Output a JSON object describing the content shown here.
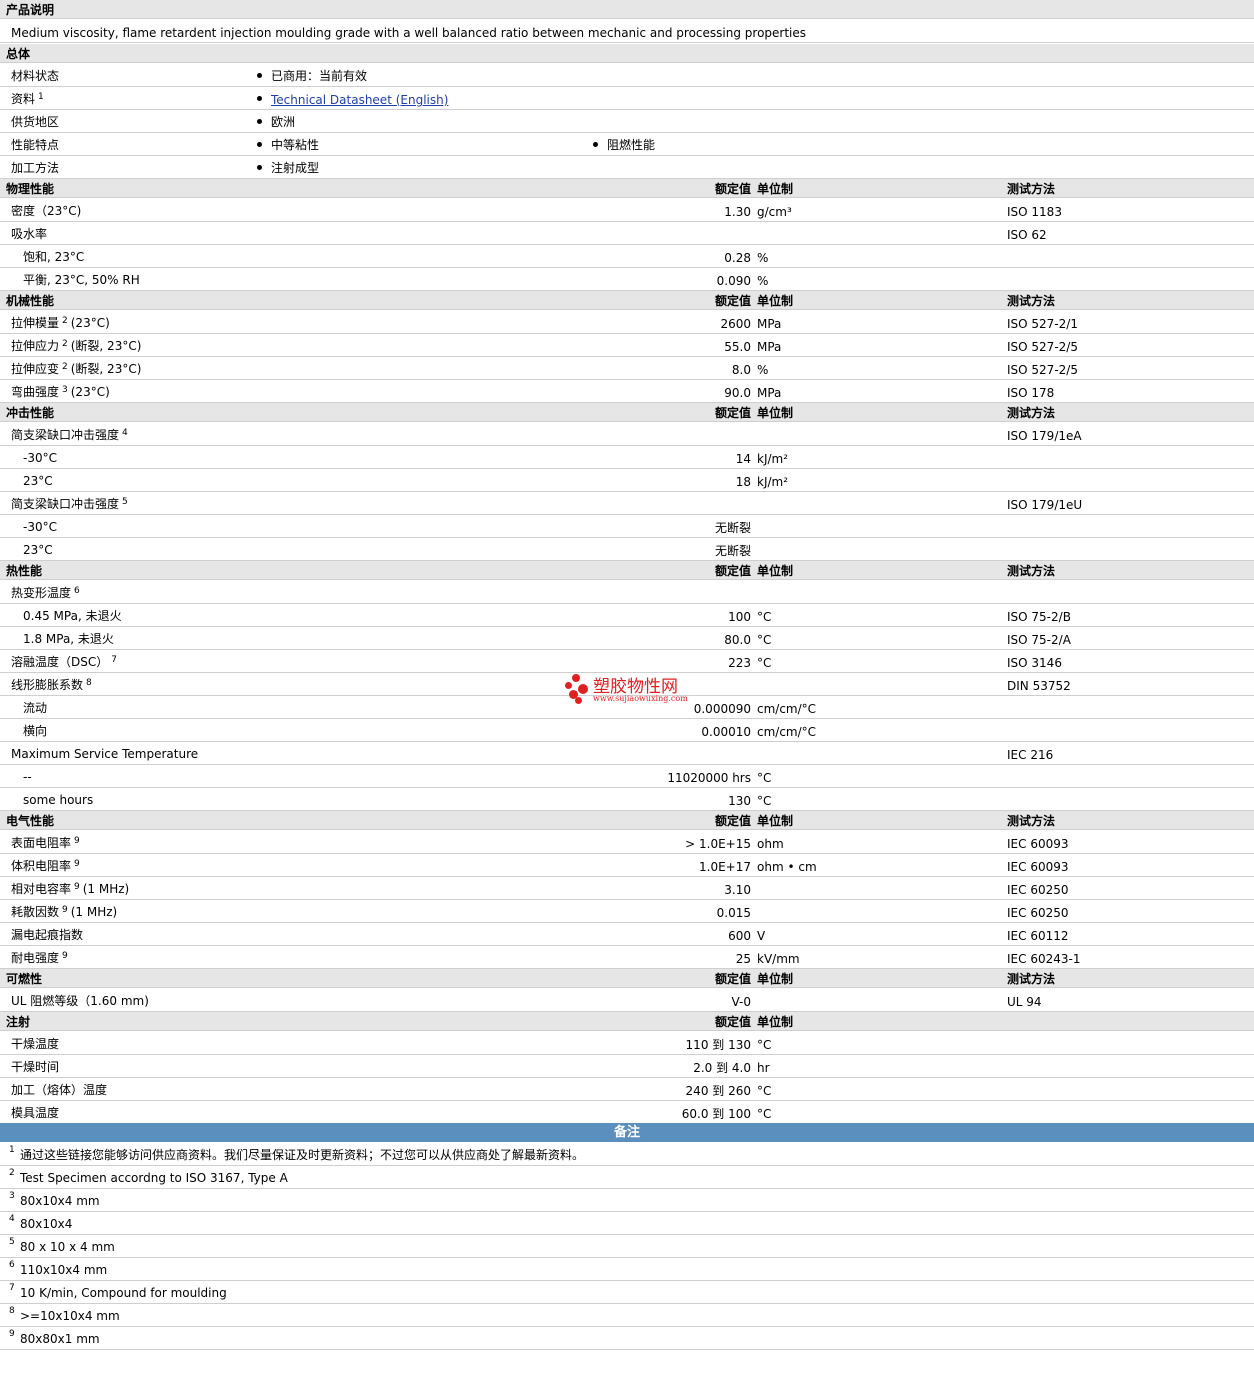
{
  "description": {
    "title": "产品说明",
    "text": "Medium viscosity, flame retardent injection moulding grade with a well balanced ratio between mechanic and processing properties"
  },
  "general": {
    "title": "总体",
    "rows": [
      {
        "label": "材料状态",
        "v1": "已商用：当前有效"
      },
      {
        "label": "资料",
        "sup": "1",
        "v1": "Technical Datasheet (English)"
      },
      {
        "label": "供货地区",
        "v1": "欧洲"
      },
      {
        "label": "性能特点",
        "v1": "中等粘性",
        "v2": "阻燃性能"
      },
      {
        "label": "加工方法",
        "v1": "注射成型"
      }
    ]
  },
  "columns": {
    "value": "额定值",
    "unit": "单位制",
    "method": "测试方法"
  },
  "sections": {
    "physical": {
      "title": "物理性能",
      "rows": [
        {
          "label": "密度（23°C)",
          "value": "1.30",
          "unit": "g/cm³",
          "method": "ISO 1183"
        },
        {
          "label": "吸水率",
          "method": "ISO 62"
        },
        {
          "label": "饱和, 23°C",
          "value": "0.28",
          "unit": "%"
        },
        {
          "label": "平衡, 23°C, 50% RH",
          "value": "0.090",
          "unit": "%"
        }
      ]
    },
    "mechanical": {
      "title": "机械性能",
      "rows": [
        {
          "label": "拉伸模量",
          "sup": "2",
          "suffix": "(23°C)",
          "value": "2600",
          "unit": "MPa",
          "method": "ISO 527-2/1"
        },
        {
          "label": "拉伸应力",
          "sup": "2",
          "suffix": "(断裂, 23°C)",
          "value": "55.0",
          "unit": "MPa",
          "method": "ISO 527-2/5"
        },
        {
          "label": "拉伸应变",
          "sup": "2",
          "suffix": "(断裂, 23°C)",
          "value": "8.0",
          "unit": "%",
          "method": "ISO 527-2/5"
        },
        {
          "label": "弯曲强度",
          "sup": "3",
          "suffix": "(23°C)",
          "value": "90.0",
          "unit": "MPa",
          "method": "ISO 178"
        }
      ]
    },
    "impact": {
      "title": "冲击性能",
      "rows": [
        {
          "label": "简支梁缺口冲击强度",
          "sup": "4",
          "method": "ISO 179/1eA"
        },
        {
          "label": "-30°C",
          "value": "14",
          "unit": "kJ/m²"
        },
        {
          "label": "23°C",
          "value": "18",
          "unit": "kJ/m²"
        },
        {
          "label": "简支梁缺口冲击强度",
          "sup": "5",
          "method": "ISO 179/1eU"
        },
        {
          "label": "-30°C",
          "value": "无断裂"
        },
        {
          "label": "23°C",
          "value": "无断裂"
        }
      ]
    },
    "thermal": {
      "title": "热性能",
      "rows": [
        {
          "label": "热变形温度",
          "sup": "6"
        },
        {
          "label": "0.45 MPa, 未退火",
          "value": "100",
          "unit": "°C",
          "method": "ISO 75-2/B"
        },
        {
          "label": "1.8 MPa, 未退火",
          "value": "80.0",
          "unit": "°C",
          "method": "ISO 75-2/A"
        },
        {
          "label": "溶融温度（DSC）",
          "sup": "7",
          "value": "223",
          "unit": "°C",
          "method": "ISO 3146"
        },
        {
          "label": "线形膨胀系数",
          "sup": "8",
          "method": "DIN 53752"
        },
        {
          "label": "流动",
          "value": "0.000090",
          "unit": "cm/cm/°C"
        },
        {
          "label": "横向",
          "value": "0.00010",
          "unit": "cm/cm/°C"
        },
        {
          "label": "Maximum Service Temperature",
          "method": "IEC 216"
        },
        {
          "label": "--",
          "value": "11020000 hrs",
          "unit": "°C"
        },
        {
          "label": "some hours",
          "value": "130",
          "unit": "°C"
        }
      ]
    },
    "electrical": {
      "title": "电气性能",
      "rows": [
        {
          "label": "表面电阻率",
          "sup": "9",
          "value": "> 1.0E+15",
          "unit": "ohm",
          "method": "IEC 60093"
        },
        {
          "label": "体积电阻率",
          "sup": "9",
          "value": "1.0E+17",
          "unit": "ohm • cm",
          "method": "IEC 60093"
        },
        {
          "label": "相对电容率",
          "sup": "9",
          "suffix": "(1 MHz)",
          "value": "3.10",
          "method": "IEC 60250"
        },
        {
          "label": "耗散因数",
          "sup": "9",
          "suffix": "(1 MHz)",
          "value": "0.015",
          "method": "IEC 60250"
        },
        {
          "label": "漏电起痕指数",
          "value": "600",
          "unit": "V",
          "method": "IEC 60112"
        },
        {
          "label": "耐电强度",
          "sup": "9",
          "value": "25",
          "unit": "kV/mm",
          "method": "IEC 60243-1"
        }
      ]
    },
    "flammability": {
      "title": "可燃性",
      "rows": [
        {
          "label": "UL 阻燃等级（1.60 mm)",
          "value": "V-0",
          "method": "UL 94"
        }
      ]
    },
    "injection": {
      "title": "注射",
      "rows": [
        {
          "label": "干燥温度",
          "value": "110 到  130",
          "unit": "°C"
        },
        {
          "label": "干燥时间",
          "value": "2.0 到  4.0",
          "unit": "hr"
        },
        {
          "label": "加工（熔体）温度",
          "value": "240 到  260",
          "unit": "°C"
        },
        {
          "label": "模具温度",
          "value": "60.0 到  100",
          "unit": "°C"
        }
      ]
    }
  },
  "notes": {
    "title": "备注",
    "items": [
      {
        "n": "1",
        "text": "通过这些链接您能够访问供应商资料。我们尽量保证及时更新资料；不过您可以从供应商处了解最新资料。"
      },
      {
        "n": "2",
        "text": "Test Specimen accordng to ISO 3167, Type A"
      },
      {
        "n": "3",
        "text": "80x10x4 mm"
      },
      {
        "n": "4",
        "text": "80x10x4"
      },
      {
        "n": "5",
        "text": "80 x 10 x 4 mm"
      },
      {
        "n": "6",
        "text": "110x10x4 mm"
      },
      {
        "n": "7",
        "text": "10 K/min, Compound for moulding"
      },
      {
        "n": "8",
        "text": ">=10x10x4 mm"
      },
      {
        "n": "9",
        "text": "80x80x1 mm"
      }
    ]
  },
  "watermark": {
    "text": "塑胶物性网",
    "url": "www.sujiaowuxing.com",
    "color": "#e02020"
  },
  "colors": {
    "header_bg": "#e6e6e6",
    "notes_bar": "#5b8fbd",
    "link": "#1f3fa6"
  }
}
